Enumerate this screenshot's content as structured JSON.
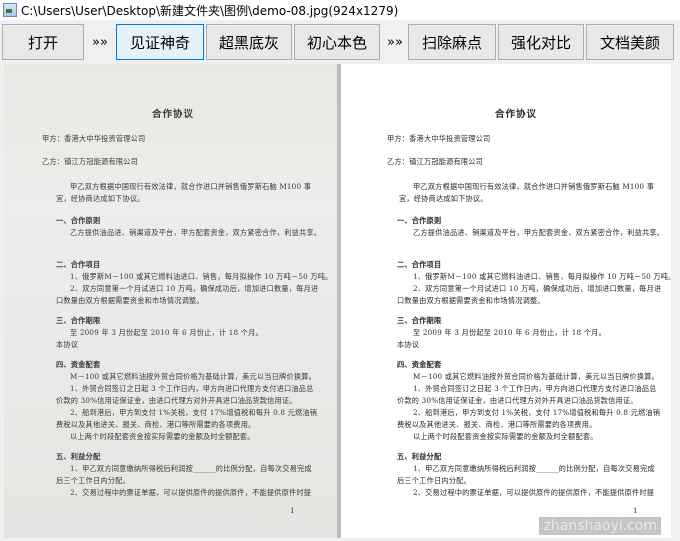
{
  "window": {
    "title": "C:\\Users\\User\\Desktop\\新建文件夹\\图例\\demo-08.jpg(924x1279)"
  },
  "toolbar": {
    "open": "打开",
    "sep1": "»»",
    "b1": "见证神奇",
    "b2": "超黑底灰",
    "b3": "初心本色",
    "sep2": "»»",
    "b4": "扫除麻点",
    "b5": "强化对比",
    "b6": "文档美颜"
  },
  "document": {
    "lines": [
      "合作协议",
      "甲方：香港大中华投资管理公司",
      "乙方：镇江万冠能源有限公司",
      "甲乙双方根据中国现行有效法律，就合作进口并销售俄罗斯石脑 M100 事",
      "宜，经协商达成如下协议。",
      "一、合作原则",
      "乙方提供油品进、销渠道及平台，甲方配套资金，双方紧密合作，利益共享。",
      "二、合作项目",
      "1、俄罗斯M－100 或其它燃料油进口、销售，每月拟操作 10 万吨－50 万吨。",
      "2、双方同意第一个月试进口 10 万吨，确保成功后，增加进口数量，每月进",
      "口数量由双方根据需要资金和市场情况调整。",
      "三、合作期限",
      "至 2009 年 3 月份起至 2010 年 6 月份止，计 18 个月。",
      "本协议",
      "四、资金配套",
      "M－100 或其它燃料油按外贸合同价格为基础计算，美元以当日牌价换算。",
      "1、外贸合同签订之日起 3 个工作日内，甲方向进口代理方支付进口油品总",
      "价款的 30%信用证保证金，由进口代理方对外开具进口油品货款信用证。",
      "2、船到港后，甲方到支付 1%关税，支付 17%增值税和每升 0.8 元燃油销",
      "费税以及其他进关、报关、商检、港口等所需要的各项费用。",
      "以上两个时段配套资金按实际需要的金额及时全额配套。",
      "五、利益分配",
      "1、甲乙双方同意缴纳所得税后利润按______的比例分配，自每次交易完成",
      "后三个工作日内分配。",
      "2、交易过程中的票证单据，可以提供原件的提供原件，不能提供原件时提",
      "1"
    ]
  },
  "watermark": "zhanshaoyi.com"
}
